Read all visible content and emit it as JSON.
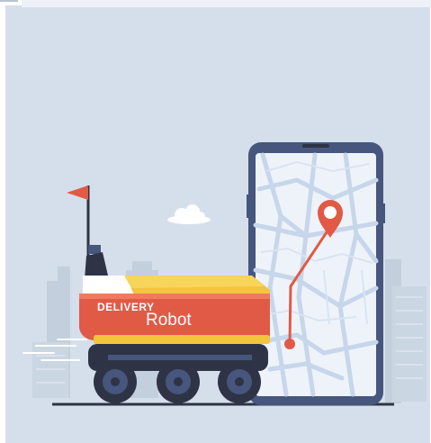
{
  "illustration": {
    "label_line1": "DELIVERY",
    "label_line2": "Robot",
    "colors": {
      "background": "#d5dfec",
      "robot_body": "#e15a45",
      "robot_top": "#f2c53d",
      "robot_dark": "#2e3445",
      "phone_frame": "#46567d",
      "map_bg": "#eef3fa",
      "map_streets": "#c7d6ea",
      "route": "#e15a45",
      "buildings": "#c3cfdd"
    },
    "icons": [
      "flag-icon",
      "map-pin-icon",
      "cloud-icon"
    ]
  }
}
